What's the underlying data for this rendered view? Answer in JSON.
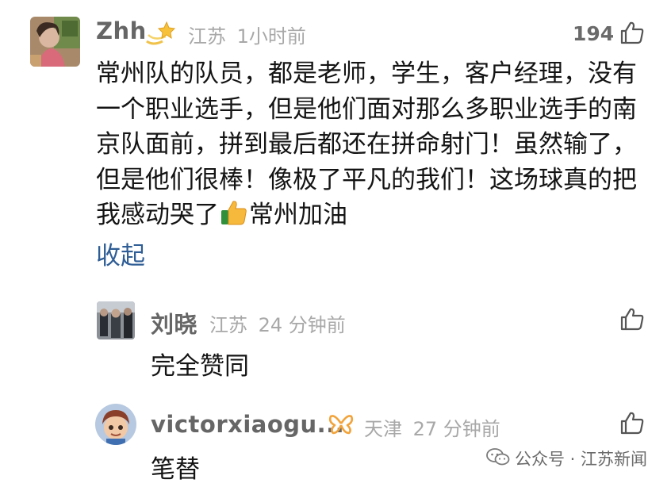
{
  "comments": [
    {
      "author": "Zhh",
      "location": "江苏",
      "time": "1小时前",
      "like_count": "194",
      "text": "常州队的队员，都是老师，学生，客户经理，没有一个职业选手，但是他们面对那么多职业选手的南京队面前，拼到最后都还在拼命射门！虽然输了，但是他们很棒！像极了平凡的我们！这场球真的把我感动哭了",
      "text_tail": "常州加油",
      "collapse_label": "收起"
    }
  ],
  "replies": [
    {
      "author": "刘晓",
      "location": "江苏",
      "time": "24 分钟前",
      "text": "完全赞同"
    },
    {
      "author": "victorxiaogu...",
      "location": "天津",
      "time": "27 分钟前",
      "text": "笔替"
    }
  ],
  "watermark": {
    "text": "公众号 · 江苏新闻"
  },
  "colors": {
    "link": "#2f5d95",
    "name": "#666666",
    "meta": "#a8a8a8"
  }
}
